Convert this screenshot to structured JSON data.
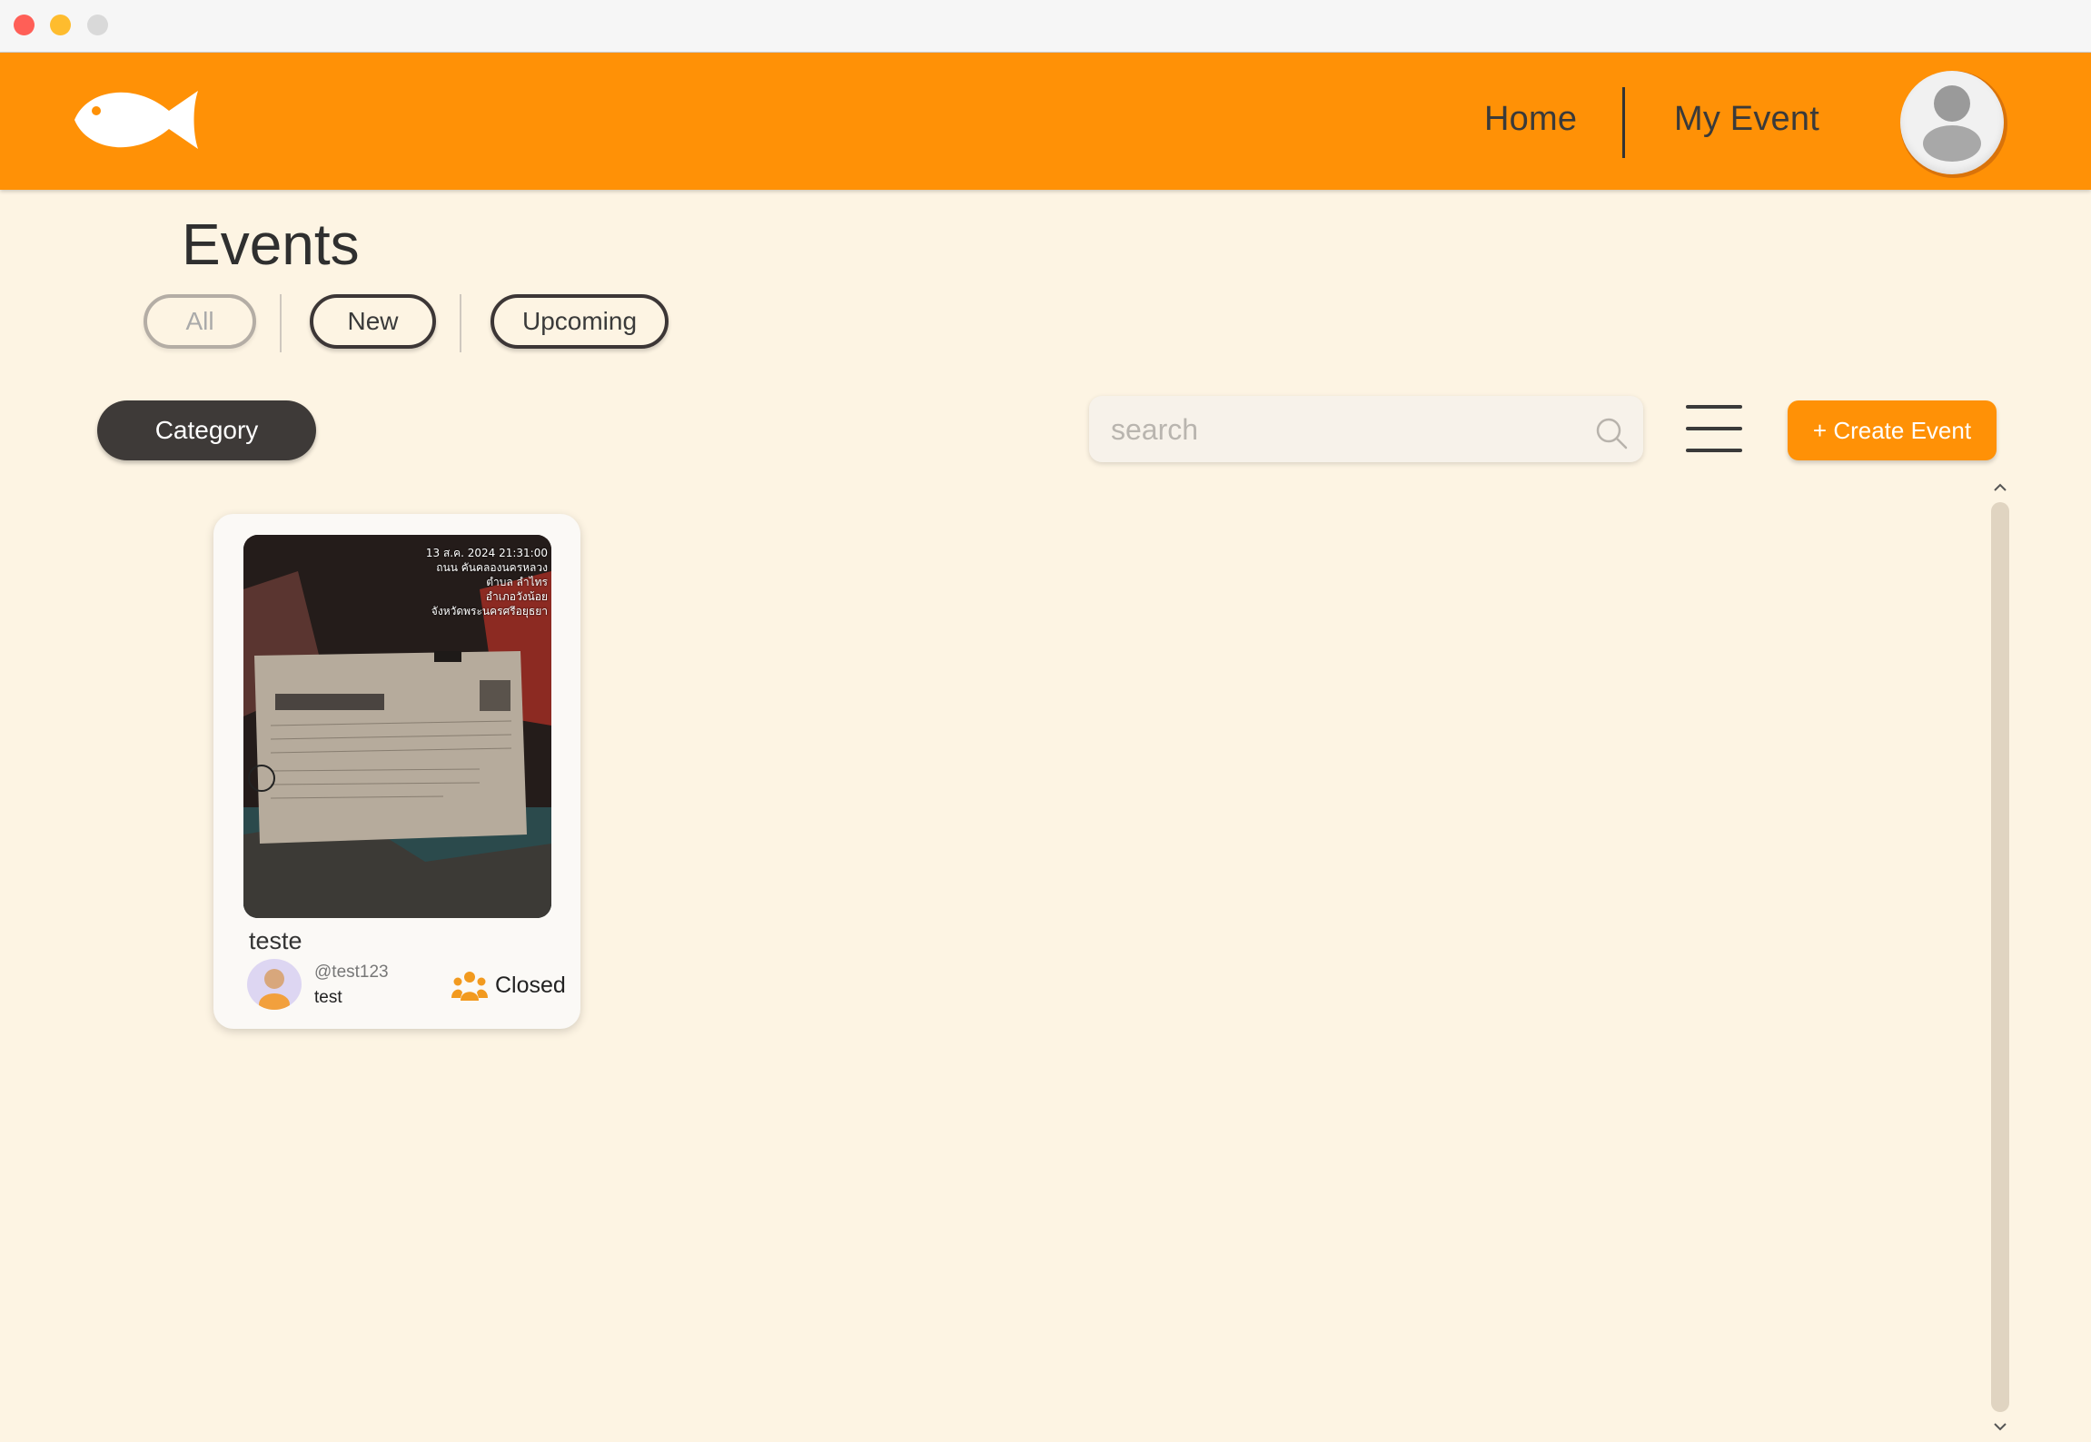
{
  "window": {
    "controls": [
      "close",
      "minimize",
      "maximize"
    ]
  },
  "header": {
    "logo_icon": "fish-icon",
    "nav": {
      "home": "Home",
      "my_event": "My Event"
    },
    "profile_icon": "user-avatar-icon",
    "accent_color": "#ff9106"
  },
  "page": {
    "title": "Events"
  },
  "filters": {
    "all": "All",
    "new": "New",
    "upcoming": "Upcoming"
  },
  "toolbar": {
    "category_label": "Category",
    "search_placeholder": "search",
    "search_value": "",
    "create_label": "+ Create Event"
  },
  "events": [
    {
      "title": "teste",
      "photo_stamp": [
        "13 ส.ค. 2024 21:31:00",
        "ถนน คันคลองนครหลวง",
        "ตำบล ลำไทร",
        "อำเภอวังน้อย",
        "จังหวัดพระนครศรีอยุธยา"
      ],
      "handle": "@test123",
      "username": "test",
      "status": "Closed",
      "status_icon": "people-icon"
    }
  ],
  "colors": {
    "background": "#fdf4e3",
    "header": "#ff9106",
    "category_button": "#3e3a38",
    "create_button": "#ff9106"
  }
}
